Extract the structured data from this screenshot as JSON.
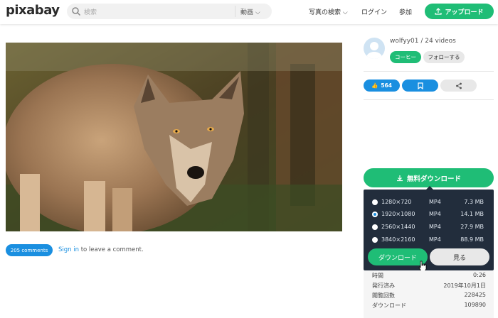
{
  "header": {
    "logo": "pixabay",
    "search_placeholder": "検索",
    "search_category": "動画",
    "nav_explore": "写真の検索",
    "nav_login": "ログイン",
    "nav_join": "参加",
    "upload_label": "アップロード"
  },
  "comments": {
    "count_label": "205 comments",
    "signin_link": "Sign in",
    "signin_rest": " to leave a comment."
  },
  "author": {
    "name_line": "wolfyy01 / 24 videos",
    "coffee_label": "コーヒー",
    "follow_label": "フォローする"
  },
  "actions": {
    "likes": "564"
  },
  "download": {
    "free_label": "無料ダウンロード",
    "options": [
      {
        "res": "1280×720",
        "format": "MP4",
        "size": "7.3 MB",
        "selected": false
      },
      {
        "res": "1920×1080",
        "format": "MP4",
        "size": "14.1 MB",
        "selected": true
      },
      {
        "res": "2560×1440",
        "format": "MP4",
        "size": "27.9 MB",
        "selected": false
      },
      {
        "res": "3840×2160",
        "format": "MP4",
        "size": "88.9 MB",
        "selected": false
      }
    ],
    "download_btn": "ダウンロード",
    "view_btn": "見る"
  },
  "stats": [
    {
      "key": "時間",
      "value": "0:26"
    },
    {
      "key": "発行済み",
      "value": "2019年10月1日"
    },
    {
      "key": "閲覧回数",
      "value": "228425"
    },
    {
      "key": "ダウンロード",
      "value": "109890"
    }
  ],
  "colors": {
    "green": "#1fbd76",
    "blue": "#1a8fe0",
    "panel": "#222d3c"
  }
}
